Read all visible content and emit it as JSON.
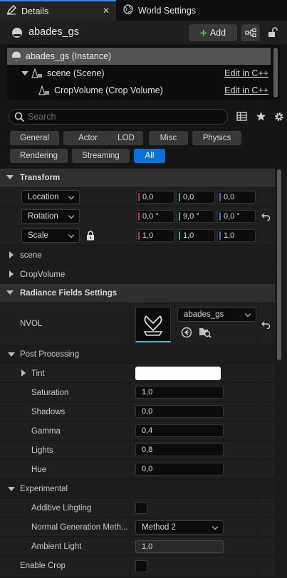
{
  "tabs": [
    {
      "label": "Details",
      "close": "✕"
    },
    {
      "label": "World Settings"
    }
  ],
  "header": {
    "actor_name": "abades_gs",
    "add_label": "Add"
  },
  "tree": {
    "rows": [
      {
        "label": "abades_gs (Instance)"
      },
      {
        "label": "scene (Scene)",
        "link": "Edit in C++"
      },
      {
        "label": "CropVolume (Crop Volume)",
        "link": "Edit in C++"
      }
    ]
  },
  "search": {
    "placeholder": "Search"
  },
  "filters": [
    "General",
    "Actor",
    "LOD",
    "Misc",
    "Physics",
    "Rendering",
    "Streaming",
    "All"
  ],
  "active_filter": "All",
  "transform": {
    "title": "Transform",
    "location": {
      "label": "Location",
      "x": "0,0",
      "y": "0,0",
      "z": "0,0"
    },
    "rotation": {
      "label": "Rotation",
      "x": "0,0 °",
      "y": "9,0 °",
      "z": "0,0 °"
    },
    "scale": {
      "label": "Scale",
      "x": "1,0",
      "y": "1,0",
      "z": "1,0"
    }
  },
  "components": {
    "scene": "scene",
    "crop": "CropVolume"
  },
  "radiance": {
    "title": "Radiance Fields Settings",
    "nvol_label": "NVOL",
    "asset_name": "abades_gs"
  },
  "post": {
    "title": "Post Processing",
    "tint_label": "Tint",
    "tint_color": "#ffffff",
    "saturation": {
      "label": "Saturation",
      "value": "1,0"
    },
    "shadows": {
      "label": "Shadows",
      "value": "0,0"
    },
    "gamma": {
      "label": "Gamma",
      "value": "0,4"
    },
    "lights": {
      "label": "Lights",
      "value": "0,8"
    },
    "hue": {
      "label": "Hue",
      "value": "0,0"
    }
  },
  "experimental": {
    "title": "Experimental",
    "additive_label": "Additive Lihgting",
    "normal_label": "Normal Generation Meth...",
    "normal_value": "Method 2",
    "ambient_label": "Ambient Light",
    "ambient_value": "1,0"
  },
  "enable_crop_label": "Enable Crop",
  "colors": {
    "accent": "#0a70d6",
    "add_green": "#4bc24b"
  }
}
